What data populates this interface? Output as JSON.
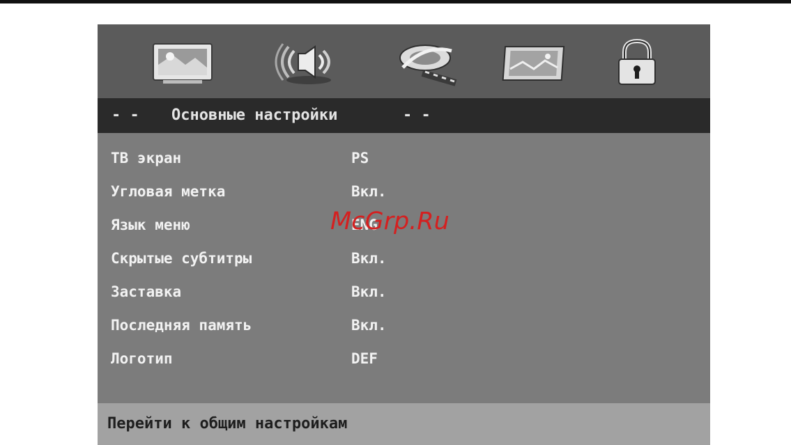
{
  "icons": [
    {
      "name": "picture-setup-icon"
    },
    {
      "name": "audio-setup-icon"
    },
    {
      "name": "video-setup-icon"
    },
    {
      "name": "preference-setup-icon"
    },
    {
      "name": "password-lock-icon"
    }
  ],
  "header": {
    "left_dashes": "- -",
    "title": "Основные настройки",
    "right_dashes": "- -"
  },
  "menu": {
    "items": [
      {
        "label": "ТВ экран",
        "value": "PS"
      },
      {
        "label": "Угловая метка",
        "value": "Вкл."
      },
      {
        "label": "Язык меню",
        "value": "ENG"
      },
      {
        "label": "Скрытые субтитры",
        "value": "Вкл."
      },
      {
        "label": "Заставка",
        "value": "Вкл."
      },
      {
        "label": "Последняя память",
        "value": "Вкл."
      },
      {
        "label": "Логотип",
        "value": "DEF"
      }
    ]
  },
  "footer": {
    "hint": "Перейти к общим настройкам"
  },
  "watermark": "McGrp.Ru",
  "colors": {
    "panel": "#7c7c7c",
    "icon_bar": "#5b5b5b",
    "header_bar": "#2a2a2a",
    "footer_bar": "#a2a2a2",
    "watermark": "#d42020"
  }
}
